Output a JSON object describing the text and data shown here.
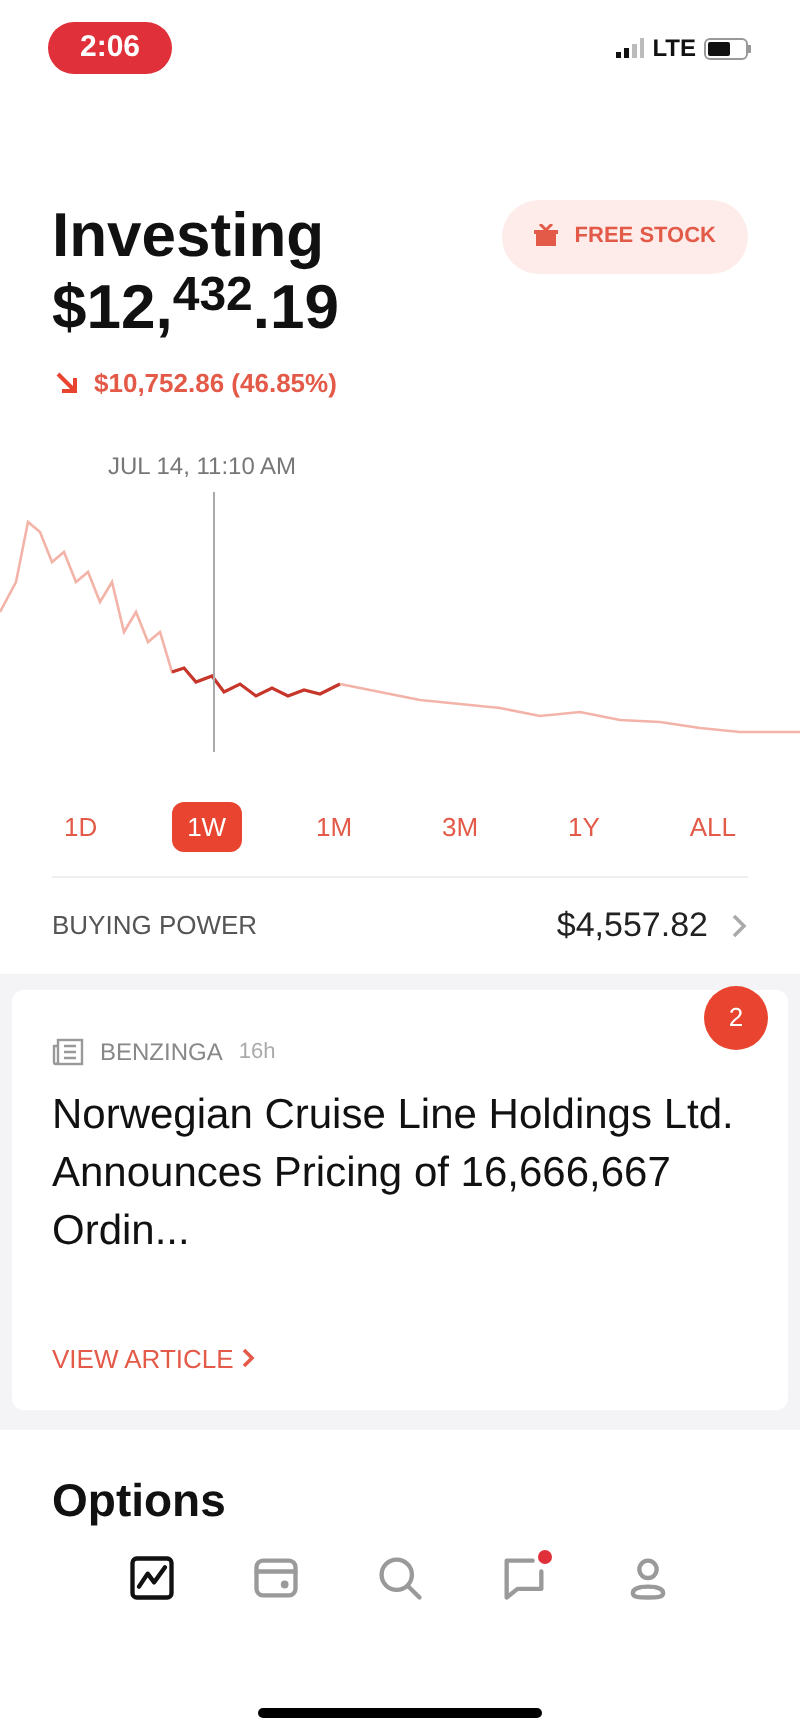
{
  "status_bar": {
    "time": "2:06",
    "network": "LTE"
  },
  "header": {
    "title": "Investing",
    "balance_prefix": "$12,",
    "balance_rolling": "432",
    "balance_suffix": ".19",
    "change": "$10,752.86 (46.85%)",
    "free_stock_button": "FREE STOCK"
  },
  "chart": {
    "scrub_label": "JUL 14, 11:10 AM"
  },
  "time_ranges": [
    {
      "label": "1D",
      "selected": false
    },
    {
      "label": "1W",
      "selected": true
    },
    {
      "label": "1M",
      "selected": false
    },
    {
      "label": "3M",
      "selected": false
    },
    {
      "label": "1Y",
      "selected": false
    },
    {
      "label": "ALL",
      "selected": false
    }
  ],
  "buying_power": {
    "label": "BUYING POWER",
    "value": "$4,557.82"
  },
  "news_card": {
    "source": "BENZINGA",
    "age": "16h",
    "headline": "Norwegian Cruise Line Holdings Ltd. Announces Pricing of 16,666,667 Ordin...",
    "link": "VIEW ARTICLE",
    "badge": "2"
  },
  "section_title": "Options",
  "tab_bar": [
    {
      "kind": "chart",
      "selected": true,
      "dot": false
    },
    {
      "kind": "wallet",
      "selected": false,
      "dot": false
    },
    {
      "kind": "search",
      "selected": false,
      "dot": false
    },
    {
      "kind": "messages",
      "selected": false,
      "dot": true
    },
    {
      "kind": "account",
      "selected": false,
      "dot": false
    }
  ]
}
